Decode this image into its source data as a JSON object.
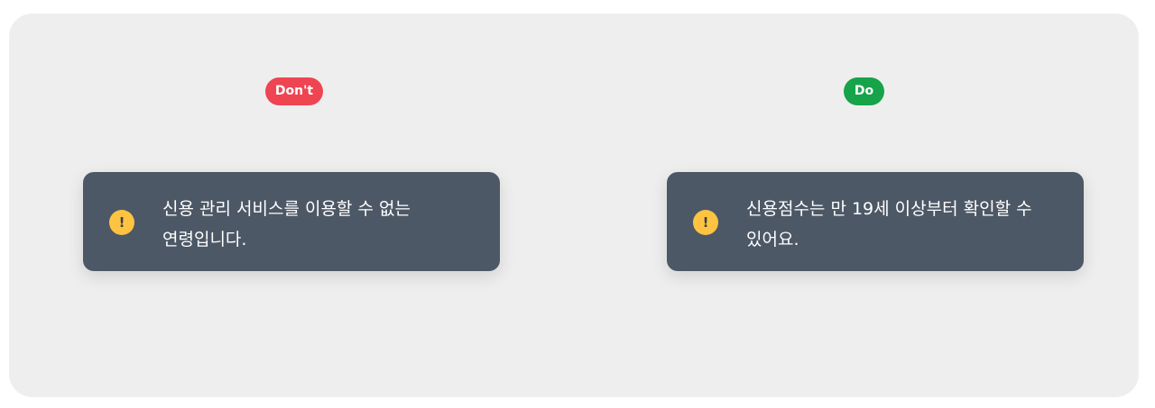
{
  "comparison": {
    "dont": {
      "badge_label": "Don't",
      "badge_color": "#ef4452",
      "toast": {
        "icon": "warning-icon",
        "icon_color": "#ffc342",
        "message_line1": "신용 관리 서비스를 이용할 수 없는",
        "message_line2": "연령입니다."
      }
    },
    "do": {
      "badge_label": "Do",
      "badge_color": "#16a34a",
      "toast": {
        "icon": "warning-icon",
        "icon_color": "#ffc342",
        "message_line1": "신용점수는 만 19세 이상부터 확인할 수",
        "message_line2": "있어요."
      }
    }
  },
  "colors": {
    "frame_background": "#eeeeee",
    "toast_background": "#4d5866",
    "toast_text": "#ffffff"
  }
}
